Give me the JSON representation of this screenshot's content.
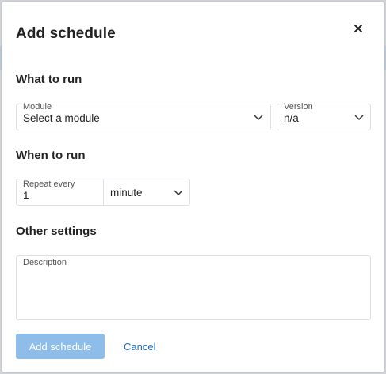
{
  "dialog": {
    "title": "Add schedule",
    "close_icon": "close-icon"
  },
  "what_to_run": {
    "heading": "What to run",
    "module": {
      "label": "Module",
      "value": "Select a module"
    },
    "version": {
      "label": "Version",
      "value": "n/a"
    }
  },
  "when_to_run": {
    "heading": "When to run",
    "repeat": {
      "label": "Repeat every",
      "value": "1",
      "unit": "minute"
    }
  },
  "other_settings": {
    "heading": "Other settings",
    "description": {
      "label": "Description",
      "value": ""
    }
  },
  "footer": {
    "submit_label": "Add schedule",
    "cancel_label": "Cancel"
  },
  "colors": {
    "primary_disabled": "#8ebde9",
    "link": "#1e6fc4",
    "border": "#dcdfe3"
  }
}
